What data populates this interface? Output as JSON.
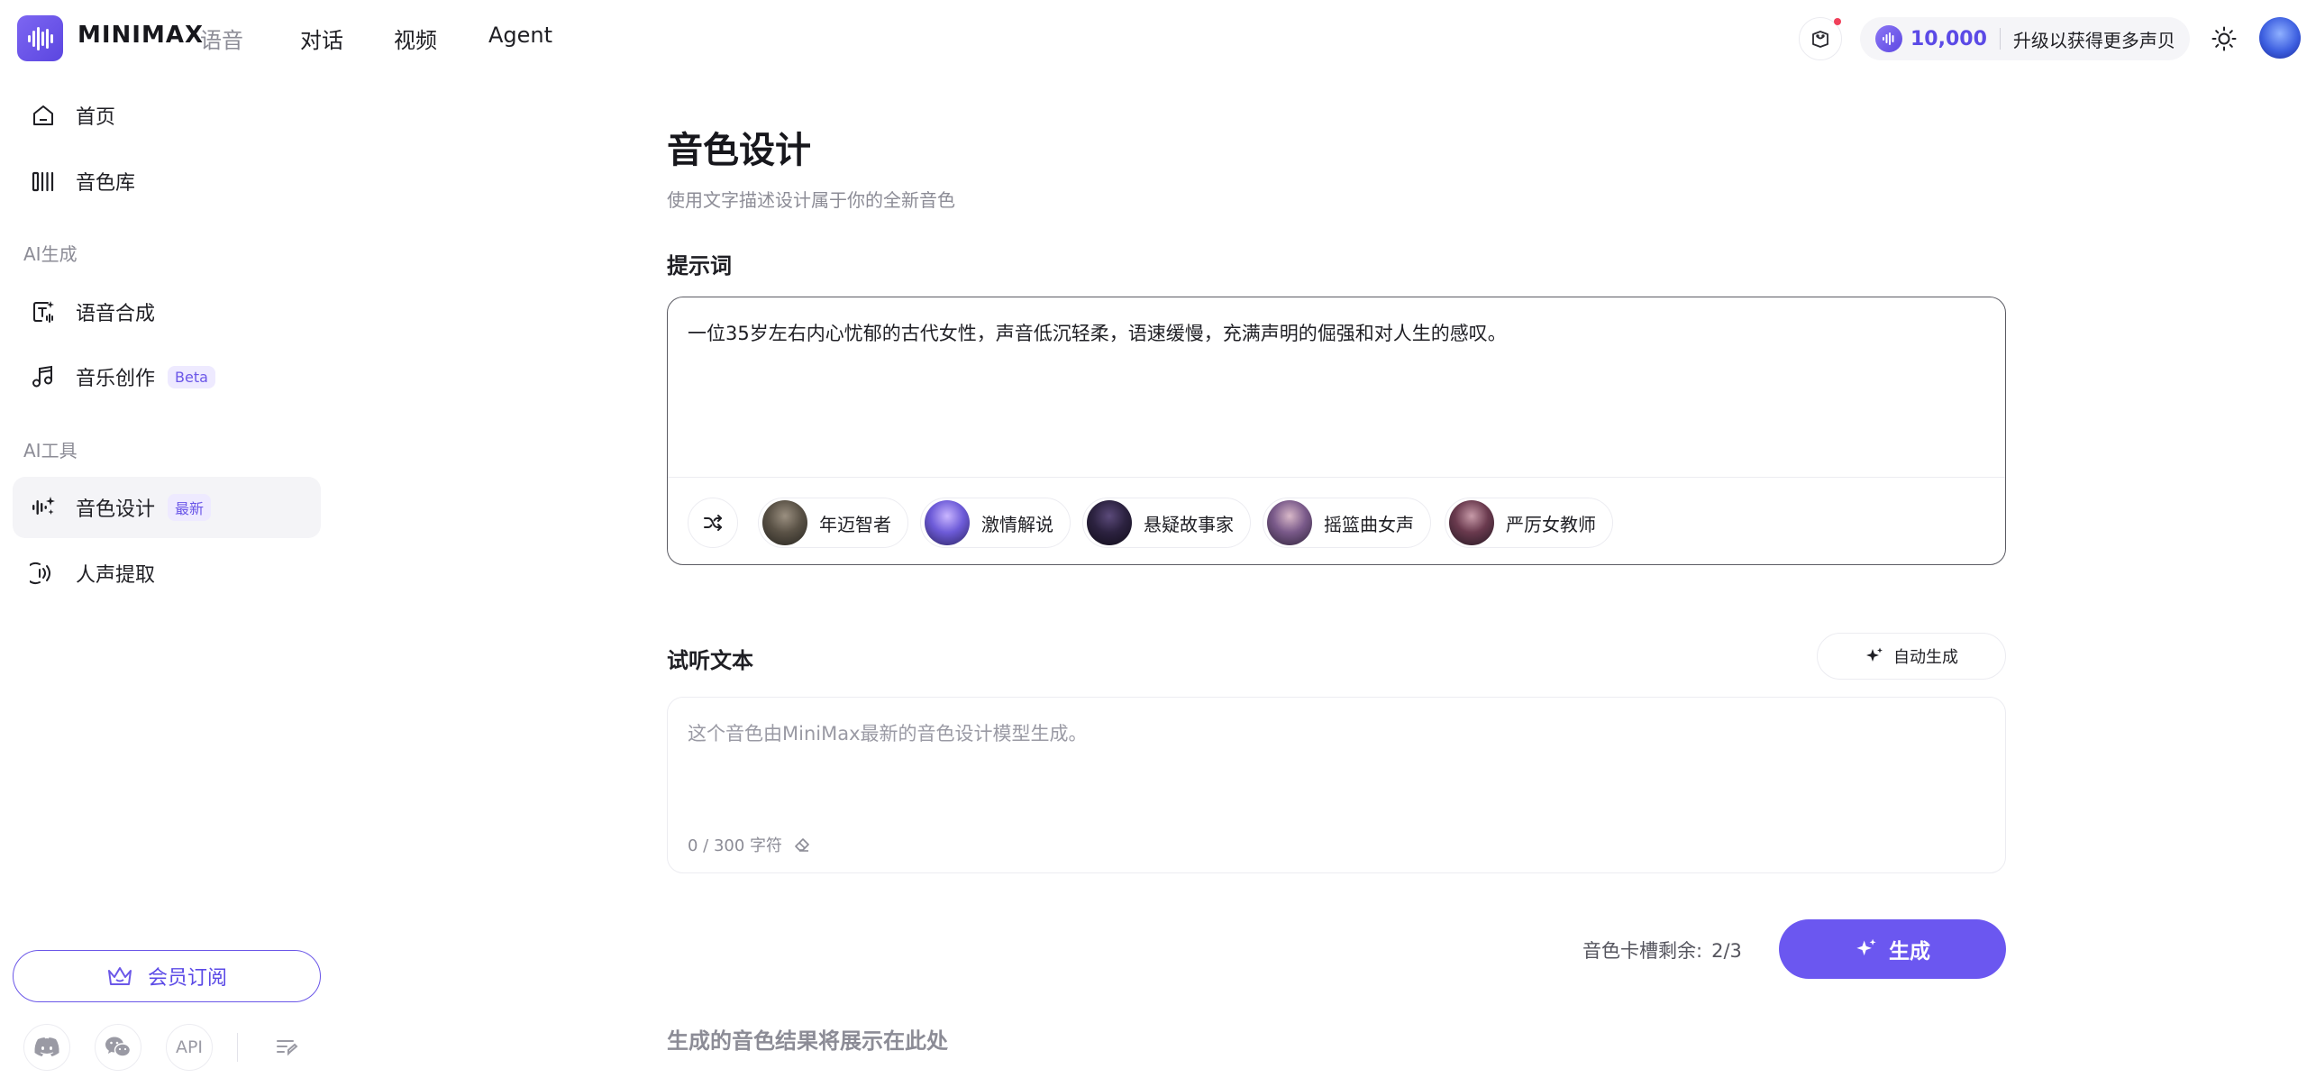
{
  "header": {
    "brand": "MINIMAX",
    "brand_sub": "语音",
    "nav": [
      "对话",
      "视频",
      "Agent"
    ],
    "credits": "10,000",
    "upgrade_label": "升级以获得更多声贝"
  },
  "sidebar": {
    "items": [
      {
        "label": "首页",
        "icon": "home-icon"
      },
      {
        "label": "音色库",
        "icon": "library-icon"
      },
      {
        "label": "语音合成",
        "icon": "tts-icon"
      },
      {
        "label": "音乐创作",
        "icon": "music-icon",
        "badge": "Beta"
      },
      {
        "label": "音色设计",
        "icon": "voice-design-icon",
        "badge": "最新",
        "active": true
      },
      {
        "label": "人声提取",
        "icon": "voice-extract-icon"
      }
    ],
    "sections": [
      "AI生成",
      "AI工具"
    ],
    "member_label": "会员订阅",
    "footer": {
      "api_label": "API"
    }
  },
  "main": {
    "title": "音色设计",
    "subtitle": "使用文字描述设计属于你的全新音色",
    "prompt_label": "提示词",
    "prompt_text": "一位35岁左右内心忧郁的古代女性，声音低沉轻柔，语速缓慢，充满声明的倔强和对人生的感叹。",
    "presets": [
      "年迈智者",
      "激情解说",
      "悬疑故事家",
      "摇篮曲女声",
      "严厉女教师"
    ],
    "listen_label": "试听文本",
    "auto_generate_label": "自动生成",
    "listen_placeholder": "这个音色由MiniMax最新的音色设计模型生成。",
    "char_counter": "0 / 300 字符",
    "slots_label": "音色卡槽剩余:",
    "slots_value": "2/3",
    "generate_label": "生成",
    "result_hint": "生成的音色结果将展示在此处"
  },
  "colors": {
    "accent": "#6b57f0",
    "accent_text": "#5b4ae6",
    "notification": "#f0405a"
  }
}
